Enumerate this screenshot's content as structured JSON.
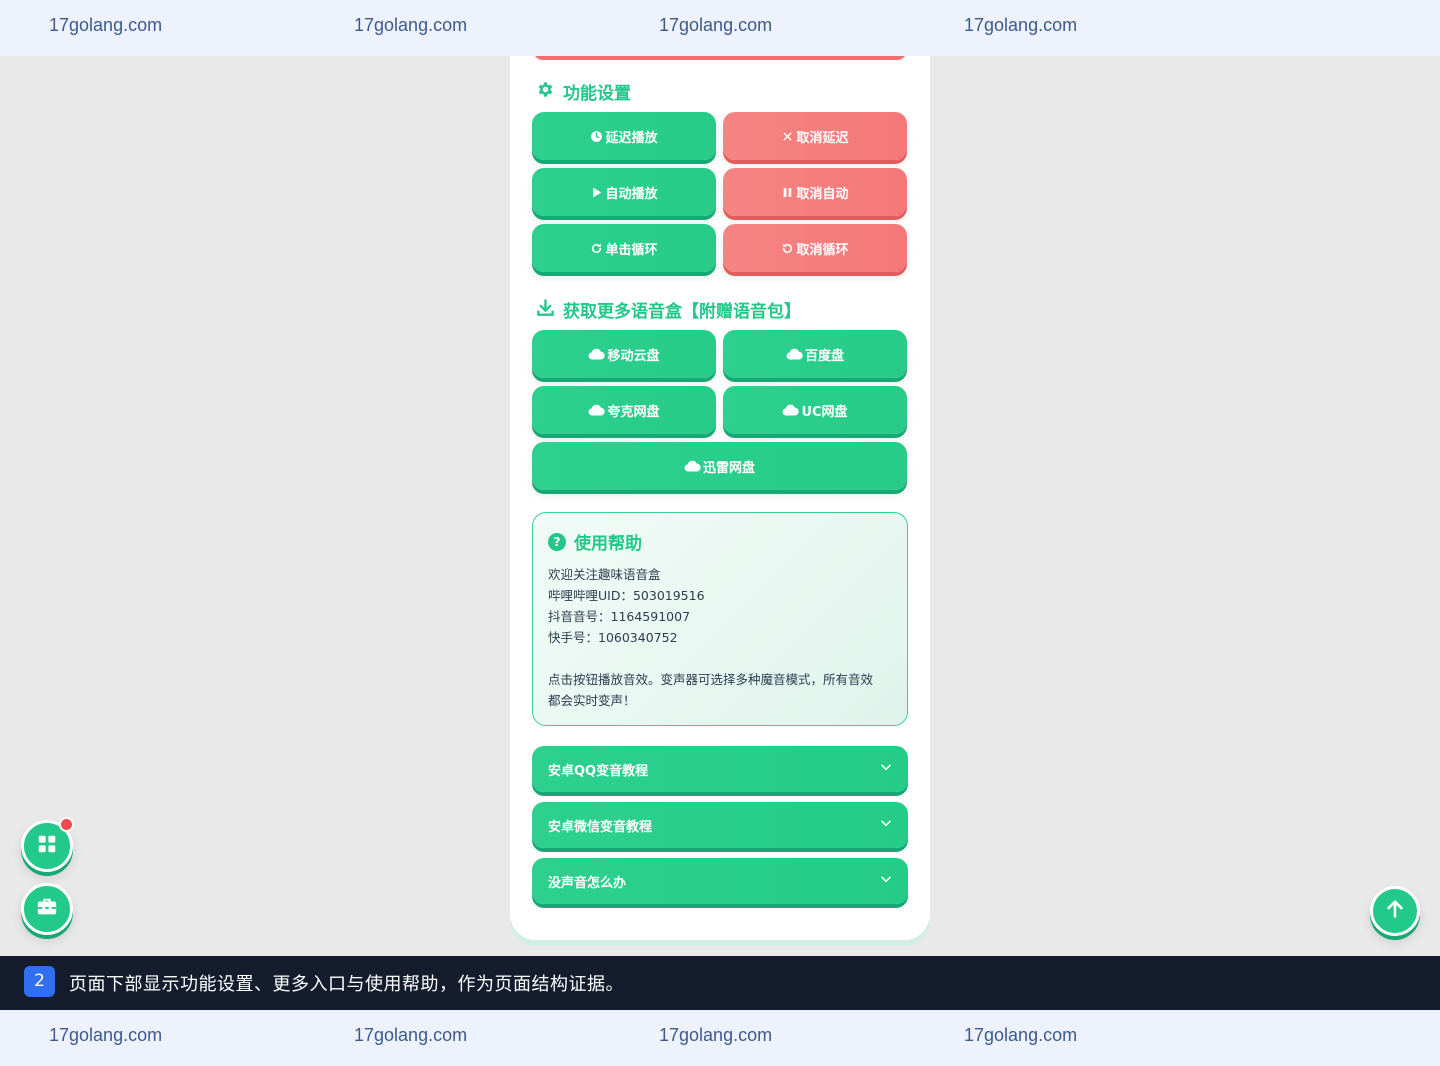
{
  "watermark": {
    "text": "17golang.com"
  },
  "feature_section": {
    "title": "功能设置",
    "buttons": [
      {
        "label": "延迟播放",
        "icon": "clock-icon",
        "color": "green"
      },
      {
        "label": "取消延迟",
        "icon": "close-icon",
        "color": "red"
      },
      {
        "label": "自动播放",
        "icon": "play-icon",
        "color": "green"
      },
      {
        "label": "取消自动",
        "icon": "pause-icon",
        "color": "red"
      },
      {
        "label": "单击循环",
        "icon": "redo-icon",
        "color": "green"
      },
      {
        "label": "取消循环",
        "icon": "undo-icon",
        "color": "red"
      }
    ]
  },
  "more_section": {
    "title": "获取更多语音盒【附赠语音包】",
    "buttons": [
      {
        "label": "移动云盘",
        "icon": "cloud-icon"
      },
      {
        "label": "百度盘",
        "icon": "cloud-icon"
      },
      {
        "label": "夸克网盘",
        "icon": "cloud-icon"
      },
      {
        "label": "UC网盘",
        "icon": "cloud-icon"
      },
      {
        "label": "迅雷网盘",
        "icon": "cloud-icon"
      }
    ]
  },
  "help": {
    "title": "使用帮助",
    "lines": [
      "欢迎关注趣味语音盒",
      "哔哩哔哩UID：503019516",
      "抖音音号：1164591007",
      "快手号：1060340752",
      "点击按钮播放音效。变声器可选择多种魔音模式，所有音效",
      "都会实时变声！"
    ]
  },
  "accordions": [
    {
      "label": "安卓QQ变音教程"
    },
    {
      "label": "安卓微信变音教程"
    },
    {
      "label": "没声音怎么办"
    }
  ],
  "caption": {
    "number": "2",
    "text": "页面下部显示功能设置、更多入口与使用帮助，作为页面结构证据。"
  },
  "colors": {
    "accent_green": "#23c78a",
    "accent_red": "#f57878",
    "badge_red": "#f04a4a",
    "caption_bg": "#141c2e",
    "caption_badge": "#2f6ff0"
  }
}
